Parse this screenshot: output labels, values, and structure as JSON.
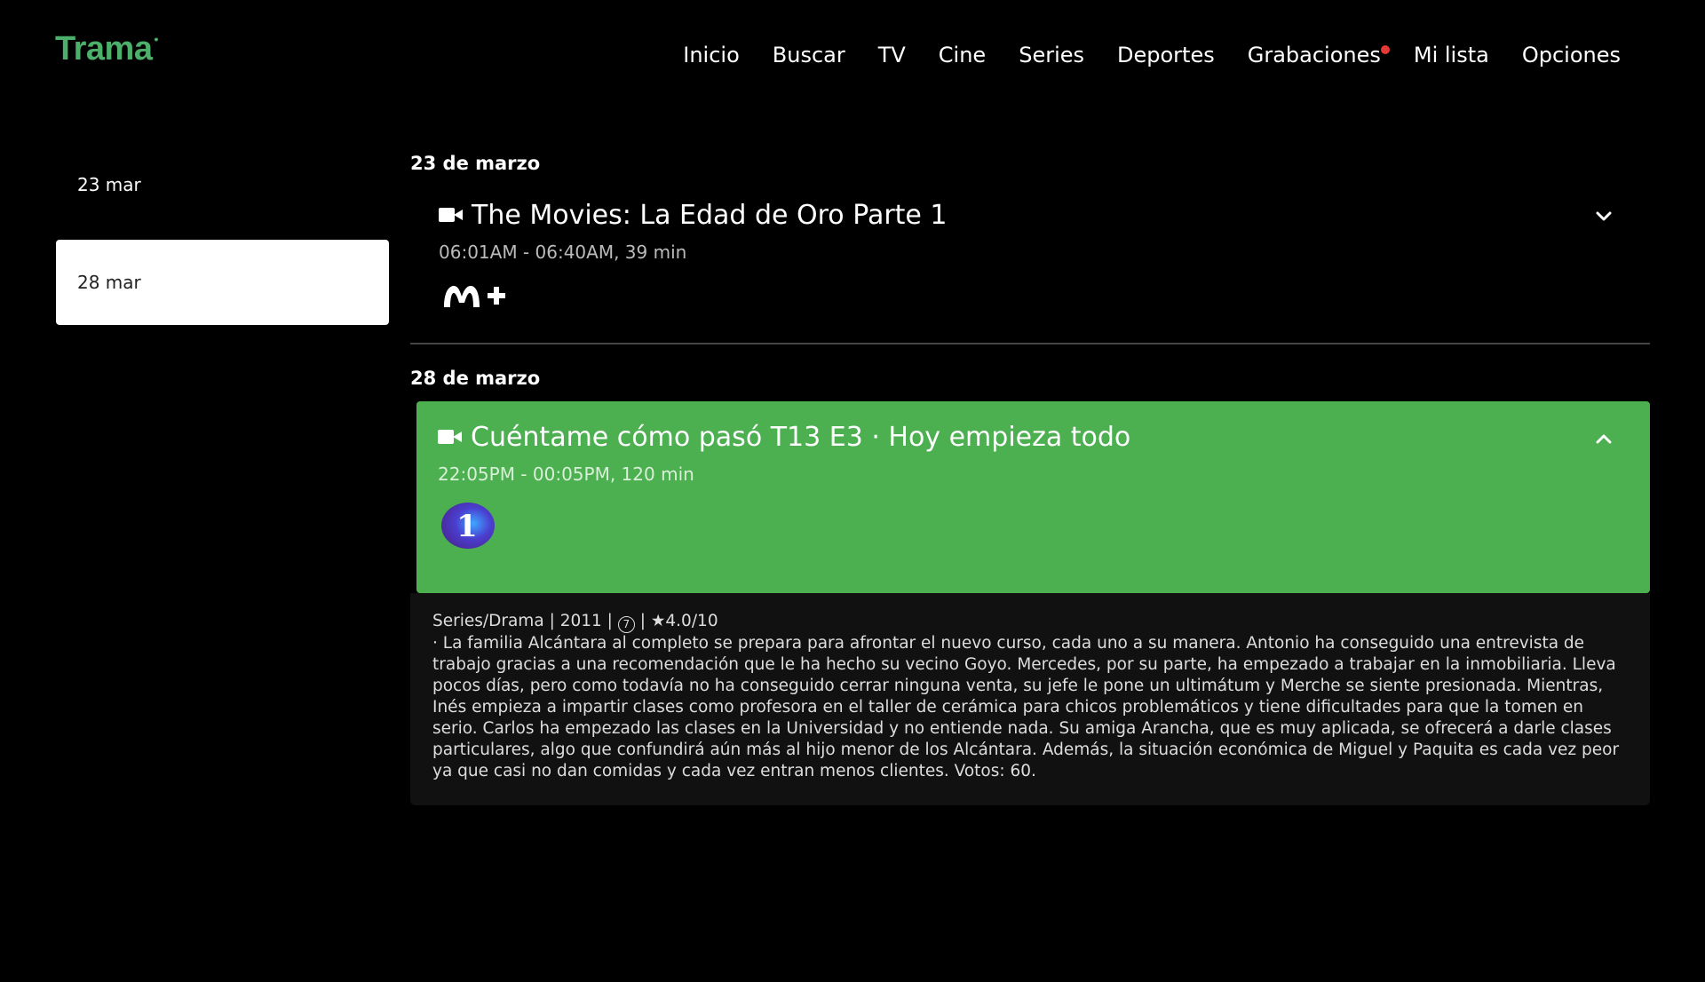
{
  "app": {
    "logo": "Trama",
    "logo_color": "#4caf6a"
  },
  "nav": {
    "items": [
      {
        "label": "Inicio"
      },
      {
        "label": "Buscar"
      },
      {
        "label": "TV"
      },
      {
        "label": "Cine"
      },
      {
        "label": "Series"
      },
      {
        "label": "Deportes"
      },
      {
        "label": "Grabaciones",
        "badge": true
      },
      {
        "label": "Mi lista"
      },
      {
        "label": "Opciones"
      }
    ],
    "badge_color": "#e53935"
  },
  "sidebar": {
    "dates": [
      {
        "label": "23 mar",
        "active": false
      },
      {
        "label": "28 mar",
        "active": true
      }
    ]
  },
  "sections": [
    {
      "heading": "23 de marzo",
      "program": {
        "icon": "video-camera-icon",
        "title": "The Movies: La Edad de Oro Parte 1",
        "time": "06:01AM - 06:40AM, 39 min",
        "channel": "M+",
        "expanded": false,
        "time_color": "#bbbbbb"
      }
    },
    {
      "heading": "28 de marzo",
      "program": {
        "icon": "video-camera-icon",
        "title": "Cuéntame cómo pasó T13 E3 · Hoy empieza todo",
        "time": "22:05PM - 00:05PM, 120 min",
        "channel": "1",
        "expanded": true,
        "background": "#4caf50",
        "time_color": "#d8f0d8"
      },
      "details": {
        "meta_genre": "Series/Drama",
        "meta_year": "2011",
        "meta_age": "7",
        "meta_rating": "★4.0/10",
        "description": "· La familia Alcántara al completo se prepara para afrontar el nuevo curso, cada uno a su manera. Antonio ha conseguido una entrevista de trabajo gracias a una recomendación que le ha hecho su vecino Goyo. Mercedes, por su parte, ha empezado a trabajar en la inmobiliaria. Lleva pocos días, pero como todavía no ha conseguido cerrar ninguna venta, su jefe le pone un ultimátum y Merche se siente presionada. Mientras, Inés empieza a impartir clases como profesora en el taller de cerámica para chicos problemáticos y tiene dificultades para que la tomen en serio. Carlos ha empezado las clases en la Universidad y no entiende nada. Su amiga Arancha, que es muy aplicada, se ofrecerá a darle clases particulares, algo que confundirá aún más al hijo menor de los Alcántara. Además, la situación económica de Miguel y Paquita es cada vez peor ya que casi no dan comidas y cada vez entran menos clientes. Votos: 60."
      }
    }
  ]
}
